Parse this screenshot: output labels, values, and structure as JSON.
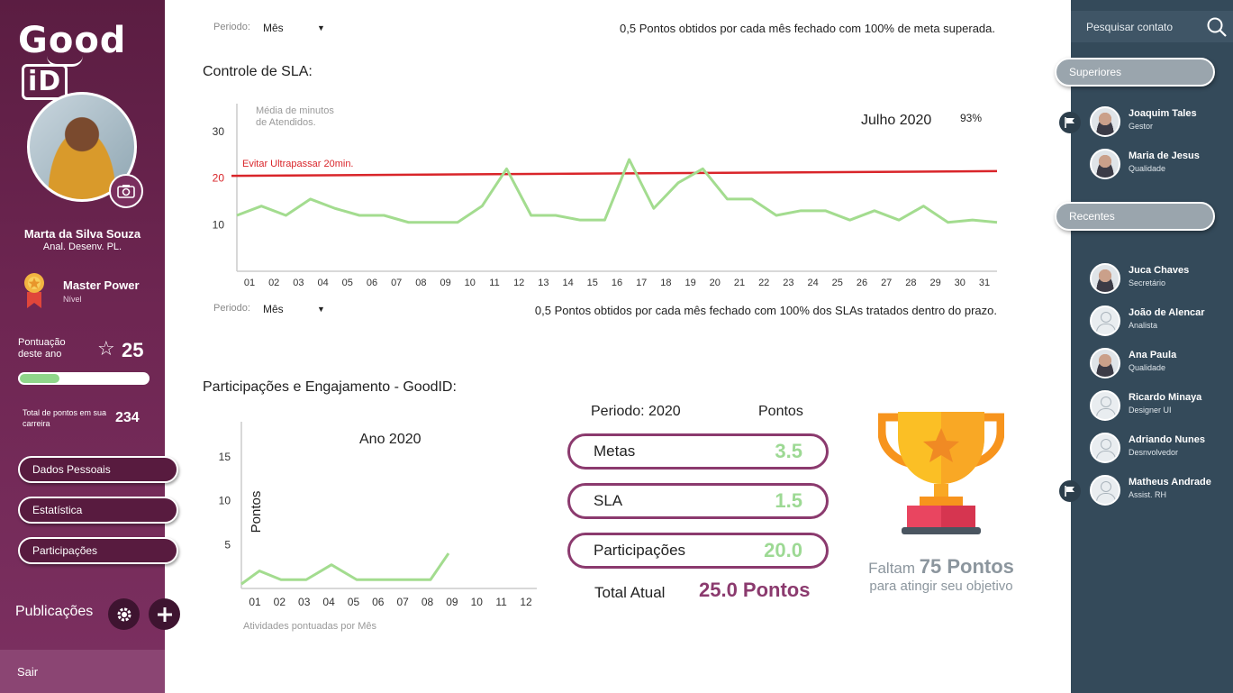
{
  "app": {
    "logo_text": "Good",
    "logo_id": "iD"
  },
  "sidebar": {
    "user_name": "Marta da Silva Souza",
    "user_role": "Anal. Desenv. PL.",
    "level_name": "Master Power",
    "level_caption": "Nível",
    "points_year_label": "Pontuação deste ano",
    "points_year_value": "25",
    "progress_fraction": 0.3,
    "career_label": "Total de pontos em sua carreira",
    "career_value": "234",
    "nav": [
      "Dados Pessoais",
      "Estatística",
      "Participações"
    ],
    "publications_label": "Publicações",
    "logout_label": "Sair"
  },
  "top_filter": {
    "label": "Periodo:",
    "value": "Mês",
    "note": "0,5 Pontos obtidos por cada mês fechado com 100% de meta superada."
  },
  "sla": {
    "title": "Controle de SLA:"
  },
  "sla_filter": {
    "label": "Periodo:",
    "value": "Mês",
    "note": "0,5 Pontos obtidos por cada mês fechado com 100% dos SLAs tratados dentro do prazo."
  },
  "participation": {
    "title": "Participações e Engajamento - GoodID:",
    "period_header": "Periodo: 2020",
    "points_header": "Pontos",
    "rows": [
      {
        "label": "Metas",
        "value": "3.5"
      },
      {
        "label": "SLA",
        "value": "1.5"
      },
      {
        "label": "Participações",
        "value": "20.0"
      }
    ],
    "total_label": "Total Atual",
    "total_value": "25.0 Pontos",
    "missing_prefix": "Faltam",
    "missing_points": "75 Pontos",
    "missing_sub": "para atingir seu objetivo"
  },
  "chart_data": [
    {
      "type": "line",
      "title": "Julho 2020",
      "subtitle_value": "93%",
      "ylabel": "Média de minutos de Atendidos.",
      "xlabel": "",
      "x": [
        "01",
        "02",
        "03",
        "04",
        "05",
        "06",
        "07",
        "08",
        "09",
        "10",
        "11",
        "12",
        "13",
        "14",
        "15",
        "16",
        "17",
        "18",
        "19",
        "20",
        "21",
        "22",
        "23",
        "24",
        "25",
        "26",
        "27",
        "28",
        "29",
        "30",
        "31"
      ],
      "yticks": [
        10,
        20,
        30
      ],
      "ylim": [
        0,
        36
      ],
      "series": [
        {
          "name": "",
          "color": "#a3dc8f",
          "values": [
            12,
            14,
            12,
            15.5,
            13.5,
            12,
            12,
            10.5,
            10.5,
            10.5,
            14,
            22,
            12,
            12,
            11,
            11,
            24,
            13.5,
            19,
            22,
            15.5,
            15.5,
            12,
            13,
            13,
            11,
            13,
            11,
            14,
            10.5,
            11,
            10.5
          ]
        }
      ],
      "threshold": {
        "label": "Evitar Ultrapassar 20min.",
        "start": 20.5,
        "end": 21.5,
        "color": "#d9252a"
      }
    },
    {
      "type": "line",
      "title": "Ano 2020",
      "ylabel": "Pontos",
      "xlabel": "Atividades pontuadas por Mês",
      "x": [
        "01",
        "02",
        "03",
        "04",
        "05",
        "06",
        "07",
        "08",
        "09",
        "10",
        "11",
        "12"
      ],
      "yticks": [
        5,
        10,
        15
      ],
      "ylim": [
        0,
        19
      ],
      "series": [
        {
          "name": "",
          "color": "#a3dc8f",
          "values": [
            0.5,
            2,
            1,
            1,
            2.7,
            1,
            1,
            1,
            1,
            4
          ]
        }
      ]
    }
  ],
  "right_sidebar": {
    "search_placeholder": "Pesquisar contato",
    "superiors_label": "Superiores",
    "recent_label": "Recentes",
    "superiors": [
      {
        "name": "Joaquim Tales",
        "role": "Gestor",
        "photo": true,
        "flag": true
      },
      {
        "name": "Maria de Jesus",
        "role": "Qualidade",
        "photo": true,
        "flag": false
      }
    ],
    "recent": [
      {
        "name": "Juca Chaves",
        "role": "Secretário",
        "photo": true,
        "flag": false
      },
      {
        "name": "João de Alencar",
        "role": "Analista",
        "photo": false,
        "flag": false
      },
      {
        "name": "Ana Paula",
        "role": "Qualidade",
        "photo": true,
        "flag": false
      },
      {
        "name": "Ricardo Minaya",
        "role": "Designer UI",
        "photo": false,
        "flag": false
      },
      {
        "name": "Adriando Nunes",
        "role": "Desnvolvedor",
        "photo": false,
        "flag": false
      },
      {
        "name": "Matheus Andrade",
        "role": "Assist. RH",
        "photo": false,
        "flag": true
      }
    ]
  }
}
